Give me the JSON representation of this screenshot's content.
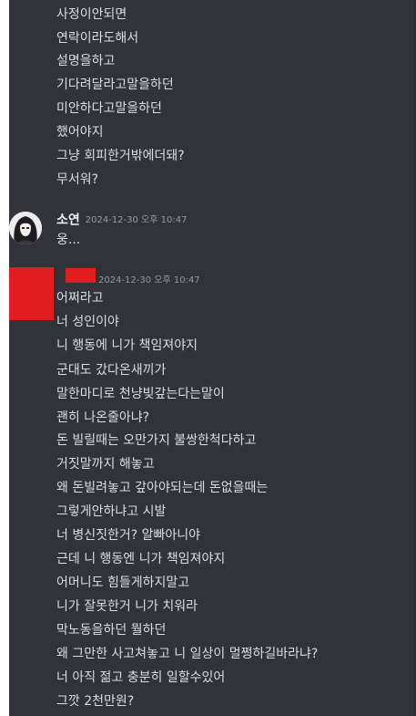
{
  "colors": {
    "background": "#313338",
    "message_text": "#dbdee1",
    "author_name": "#f2f3f5",
    "timestamp": "#949ba4",
    "redaction": "#e11d1f"
  },
  "earlier_messages": [
    "사정이안되면",
    "연락이라도해서",
    "설명을하고",
    "기다려달라고말을하던",
    "미안하다고말을하던",
    "했어야지",
    "그냥 회피한거밖에더돼?",
    "무서워?"
  ],
  "message_group_1": {
    "avatar_icon": "anime-avatar-icon",
    "author": "소연",
    "timestamp": "2024-12-30 오후 10:47",
    "lines": [
      "웅..."
    ]
  },
  "message_group_2": {
    "author_redacted": true,
    "timestamp": "2024-12-30 오후 10:47",
    "lines": [
      "어쩌라고",
      "너 성인이야",
      "니 행동에 니가 책임져야지",
      "군대도 갔다온새끼가",
      "말한마디로 천냥빚갚는다는말이",
      "괜히 나온줄아냐?",
      "돈 빌릴때는 오만가지 불쌍한척다하고",
      "거짓말까지 해놓고",
      "왜 돈빌려놓고 갚아야되는데 돈없을때는",
      "그렇게안하냐고 시발",
      "너 병신짓한거? 알빠아니야",
      "근데 니 행동엔 니가 책임져야지",
      "어머니도 힘들게하지말고",
      "니가 잘못한거 니가 치워라",
      "막노동을하던 뭘하던",
      "왜 그만한 사고쳐놓고 니 일상이 멀쩡하길바라냐?",
      "너 아직 젊고 충분히 일할수있어",
      "그깟 2천만원?"
    ]
  }
}
